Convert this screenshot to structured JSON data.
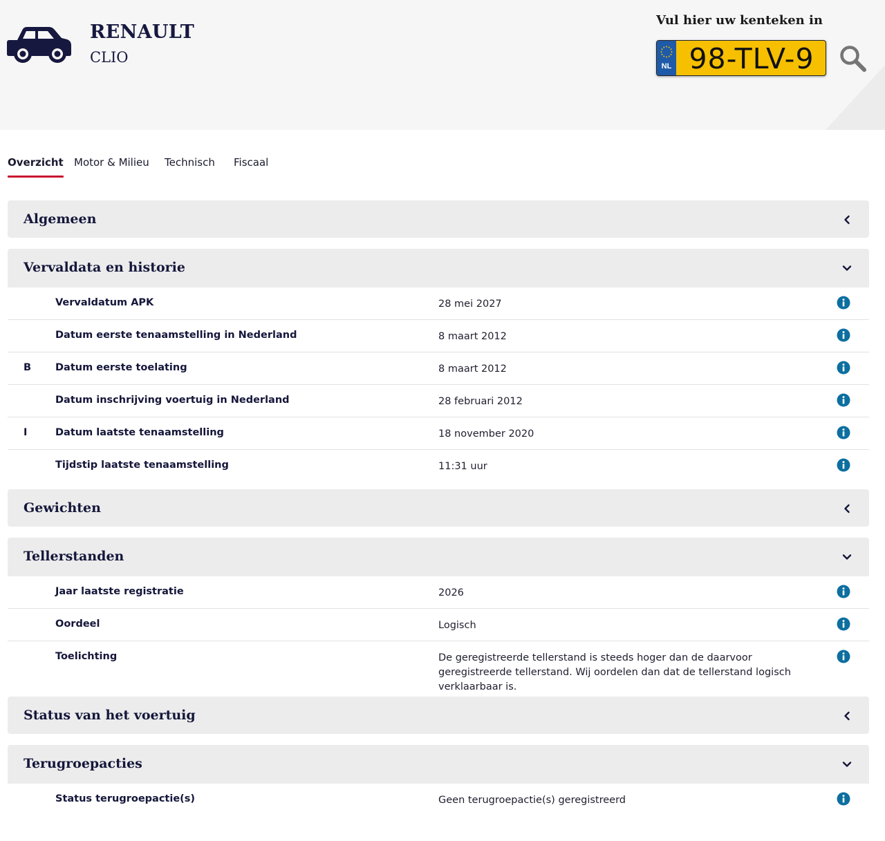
{
  "header": {
    "brand": "RENAULT",
    "model": "CLIO",
    "plate_label": "Vul hier uw kenteken in",
    "plate_number": "98-TLV-9",
    "plate_country": "NL",
    "plate_color": "#f6c000"
  },
  "tabs": [
    {
      "label": "Overzicht",
      "active": true
    },
    {
      "label": "Motor & Milieu"
    },
    {
      "label": "Technisch"
    },
    {
      "label": "Fiscaal"
    }
  ],
  "sections": {
    "algemeen": {
      "title": "Algemeen",
      "state": "collapsed"
    },
    "vervaldata": {
      "title": "Vervaldata en historie",
      "state": "expanded",
      "rows": [
        {
          "code": "",
          "label": "Vervaldatum APK",
          "value": "28 mei 2027"
        },
        {
          "code": "",
          "label": "Datum eerste tenaamstelling in Nederland",
          "value": "8 maart 2012"
        },
        {
          "code": "B",
          "label": "Datum eerste toelating",
          "value": "8 maart 2012"
        },
        {
          "code": "",
          "label": "Datum inschrijving voertuig in Nederland",
          "value": "28 februari 2012"
        },
        {
          "code": "I",
          "label": "Datum laatste tenaamstelling",
          "value": "18 november 2020"
        },
        {
          "code": "",
          "label": "Tijdstip laatste tenaamstelling",
          "value": "11:31 uur"
        }
      ]
    },
    "gewichten": {
      "title": "Gewichten",
      "state": "collapsed"
    },
    "tellerstanden": {
      "title": "Tellerstanden",
      "state": "expanded",
      "rows": [
        {
          "code": "",
          "label": "Jaar laatste registratie",
          "value": "2026"
        },
        {
          "code": "",
          "label": "Oordeel",
          "value": "Logisch"
        },
        {
          "code": "",
          "label": "Toelichting",
          "value": "De geregistreerde tellerstand is steeds hoger dan de daarvoor geregistreerde tellerstand. Wij oordelen dan dat de tellerstand logisch verklaarbaar is."
        }
      ]
    },
    "status": {
      "title": "Status van het voertuig",
      "state": "collapsed"
    },
    "terugroepacties": {
      "title": "Terugroepacties",
      "state": "expanded",
      "rows": [
        {
          "code": "",
          "label": "Status terugroepactie(s)",
          "value": "Geen terugroepactie(s) geregistreerd"
        }
      ]
    }
  },
  "colors": {
    "accent": "#c8102e",
    "info": "#0c6fa0",
    "navy": "#16183f",
    "section_bg": "#ececec",
    "header_bg": "#f6f6f6"
  }
}
